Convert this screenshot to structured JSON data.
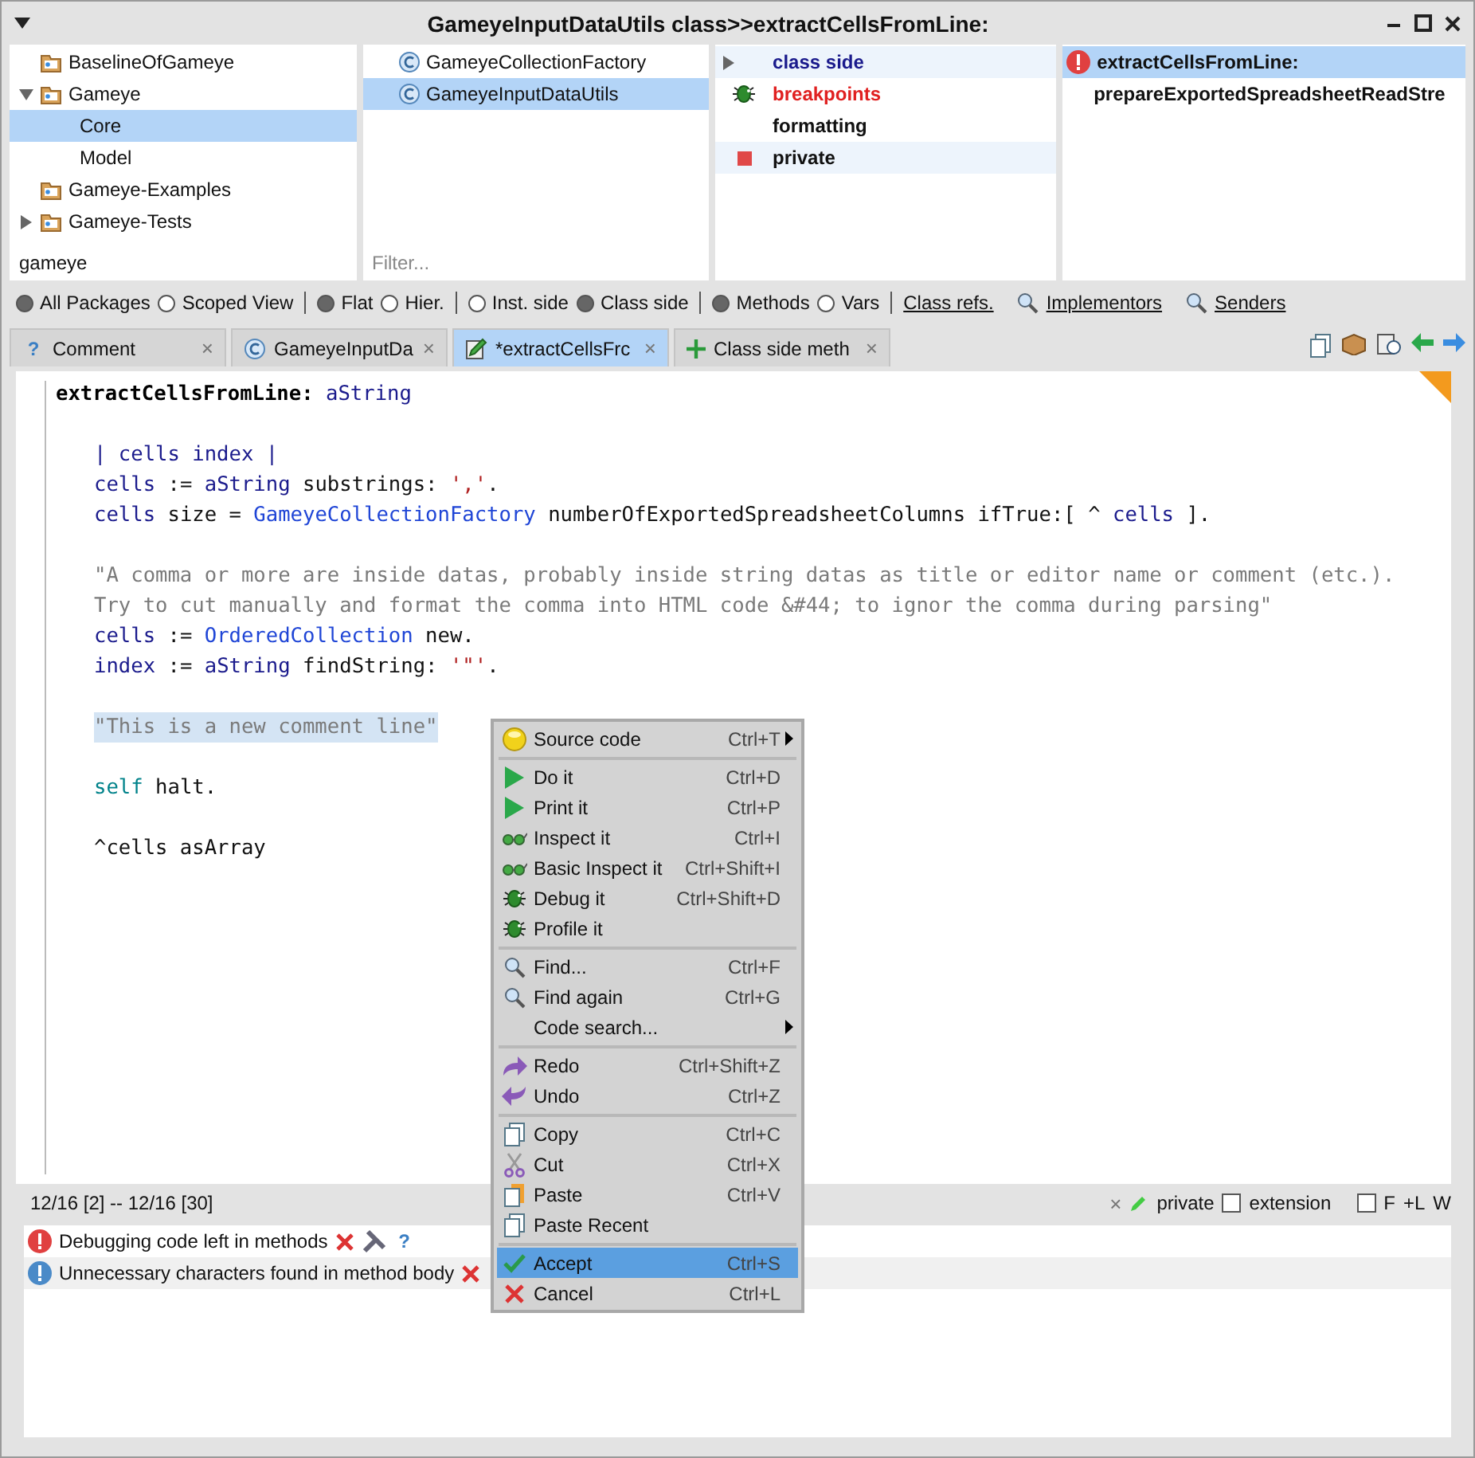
{
  "window": {
    "title": "GameyeInputDataUtils class>>extractCellsFromLine:"
  },
  "packages": {
    "items": [
      {
        "label": "BaselineOfGameye",
        "kind": "leaf",
        "selected": false
      },
      {
        "label": "Gameye",
        "kind": "expanded",
        "selected": false,
        "children": [
          {
            "label": "Core",
            "selected": true
          },
          {
            "label": "Model",
            "selected": false
          }
        ]
      },
      {
        "label": "Gameye-Examples",
        "kind": "leaf",
        "selected": false
      },
      {
        "label": "Gameye-Tests",
        "kind": "collapsed",
        "selected": false
      }
    ],
    "filter": "gameye"
  },
  "classes": {
    "items": [
      {
        "label": "GameyeCollectionFactory",
        "selected": false
      },
      {
        "label": "GameyeInputDataUtils",
        "selected": true
      }
    ],
    "filter_placeholder": "Filter..."
  },
  "protocols": {
    "items": [
      {
        "label": "class side",
        "kind": "side",
        "shaded": true
      },
      {
        "label": "breakpoints",
        "kind": "bug",
        "shaded": false
      },
      {
        "label": "formatting",
        "kind": "plain",
        "shaded": false
      },
      {
        "label": "private",
        "kind": "square",
        "shaded": true
      }
    ]
  },
  "methods": {
    "items": [
      {
        "label": "extractCellsFromLine:",
        "kind": "error",
        "selected": true
      },
      {
        "label": "prepareExportedSpreadsheetReadStre",
        "kind": "plain",
        "selected": false
      }
    ]
  },
  "toolbar": [
    {
      "kind": "radio",
      "label": "All Packages",
      "on": true
    },
    {
      "kind": "radio",
      "label": "Scoped View",
      "on": false
    },
    {
      "kind": "sep"
    },
    {
      "kind": "radio",
      "label": "Flat",
      "on": true
    },
    {
      "kind": "radio",
      "label": "Hier.",
      "on": false
    },
    {
      "kind": "sep"
    },
    {
      "kind": "radio",
      "label": "Inst. side",
      "on": false
    },
    {
      "kind": "radio",
      "label": "Class side",
      "on": true
    },
    {
      "kind": "sep"
    },
    {
      "kind": "radio",
      "label": "Methods",
      "on": true
    },
    {
      "kind": "radio",
      "label": "Vars",
      "on": false
    },
    {
      "kind": "sep"
    },
    {
      "kind": "link",
      "label": "Class refs."
    },
    {
      "kind": "search_link",
      "label": "Implementors"
    },
    {
      "kind": "search_link",
      "label": "Senders"
    }
  ],
  "tabs": [
    {
      "label": "Comment",
      "kind": "help",
      "icon_char": "?",
      "close": "×",
      "selected": false
    },
    {
      "label": "GameyeInputDa",
      "kind": "class",
      "close": "×",
      "selected": false
    },
    {
      "label": "*extractCellsFrc",
      "kind": "edit",
      "close": "×",
      "selected": true
    },
    {
      "label": "Class side meth",
      "kind": "plus",
      "close": "×",
      "selected": false
    }
  ],
  "code": [
    {
      "kind": "signature",
      "tokens": [
        {
          "t": "extractCellsFromLine:",
          "kind": "sel"
        },
        {
          "t": " aString",
          "kind": "arg"
        }
      ]
    },
    {
      "kind": "blank"
    },
    {
      "kind": "statement",
      "highlighted": false,
      "tokens": [
        {
          "t": "| cells index |",
          "kind": "tmp"
        }
      ]
    },
    {
      "kind": "statement",
      "highlighted": false,
      "tokens": [
        {
          "t": "cells",
          "kind": "tmp"
        },
        {
          "t": " := ",
          "kind": "txt"
        },
        {
          "t": "aString",
          "kind": "arg"
        },
        {
          "t": " substrings: ",
          "kind": "txt"
        },
        {
          "t": "','",
          "kind": "str"
        },
        {
          "t": ".",
          "kind": "txt"
        }
      ]
    },
    {
      "kind": "statement",
      "highlighted": false,
      "tokens": [
        {
          "t": "cells",
          "kind": "tmp"
        },
        {
          "t": " size = ",
          "kind": "txt"
        },
        {
          "t": "GameyeCollectionFactory",
          "kind": "cls"
        },
        {
          "t": " numberOfExportedSpreadsheetColumns ifTrue:[ ^ ",
          "kind": "txt"
        },
        {
          "t": "cells",
          "kind": "tmp"
        },
        {
          "t": " ].",
          "kind": "txt"
        }
      ]
    },
    {
      "kind": "blank"
    },
    {
      "kind": "statement",
      "highlighted": false,
      "tokens": [
        {
          "t": "\"A comma or more are inside datas, probably inside string datas as title or editor name or comment (etc.).",
          "kind": "cmt"
        }
      ]
    },
    {
      "kind": "statement",
      "highlighted": false,
      "tokens": [
        {
          "t": "Try to cut manually and format the comma into HTML code &#44; to ignor the comma during parsing\"",
          "kind": "cmt"
        }
      ]
    },
    {
      "kind": "statement",
      "highlighted": false,
      "tokens": [
        {
          "t": "cells",
          "kind": "tmp"
        },
        {
          "t": " := ",
          "kind": "txt"
        },
        {
          "t": "OrderedCollection",
          "kind": "cls"
        },
        {
          "t": " new.",
          "kind": "txt"
        }
      ]
    },
    {
      "kind": "statement",
      "highlighted": false,
      "tokens": [
        {
          "t": "index",
          "kind": "tmp"
        },
        {
          "t": " := ",
          "kind": "txt"
        },
        {
          "t": "aString",
          "kind": "arg"
        },
        {
          "t": " findString: ",
          "kind": "txt"
        },
        {
          "t": "'\"'",
          "kind": "str"
        },
        {
          "t": ".",
          "kind": "txt"
        }
      ]
    },
    {
      "kind": "blank"
    },
    {
      "kind": "statement",
      "highlighted": true,
      "tokens": [
        {
          "t": "\"This is a new comment line\"",
          "kind": "cmt"
        }
      ]
    },
    {
      "kind": "blank"
    },
    {
      "kind": "statement",
      "highlighted": false,
      "tokens": [
        {
          "t": "self",
          "kind": "self"
        },
        {
          "t": " halt.",
          "kind": "txt"
        }
      ]
    },
    {
      "kind": "blank"
    },
    {
      "kind": "statement",
      "highlighted": false,
      "tokens": [
        {
          "t": "^cells asArray",
          "kind": "txt"
        }
      ]
    }
  ],
  "status": {
    "position": "12/16 [2] -- 12/16 [30]",
    "clear": "×",
    "protocol": "private",
    "extension": {
      "label": "extension",
      "checked": false
    },
    "flag": {
      "label": "F",
      "checked": false
    },
    "line_mode": "+L",
    "wrap": "W"
  },
  "critiques": [
    {
      "kind": "error",
      "label": "Debugging code left in methods",
      "help": "?"
    },
    {
      "kind": "info",
      "label": "Unnecessary characters found in method body"
    }
  ],
  "context_menu": [
    {
      "kind": "bulb",
      "label": "Source code",
      "shortcut": "Ctrl+T",
      "submenu": true,
      "selected": false
    },
    {
      "kind": "separator"
    },
    {
      "kind": "play",
      "label": "Do it",
      "shortcut": "Ctrl+D",
      "submenu": false,
      "selected": false
    },
    {
      "kind": "play",
      "label": "Print it",
      "shortcut": "Ctrl+P",
      "submenu": false,
      "selected": false
    },
    {
      "kind": "glasses",
      "label": "Inspect it",
      "shortcut": "Ctrl+I",
      "submenu": false,
      "selected": false
    },
    {
      "kind": "glasses",
      "label": "Basic Inspect it",
      "shortcut": "Ctrl+Shift+I",
      "submenu": false,
      "selected": false
    },
    {
      "kind": "bug",
      "label": "Debug it",
      "shortcut": "Ctrl+Shift+D",
      "submenu": false,
      "selected": false
    },
    {
      "kind": "bug",
      "label": "Profile it",
      "submenu": false,
      "selected": false
    },
    {
      "kind": "separator"
    },
    {
      "kind": "search",
      "label": "Find...",
      "shortcut": "Ctrl+F",
      "submenu": false,
      "selected": false
    },
    {
      "kind": "search",
      "label": "Find again",
      "shortcut": "Ctrl+G",
      "submenu": false,
      "selected": false
    },
    {
      "kind": "plain",
      "label": "Code search...",
      "submenu": true,
      "selected": false
    },
    {
      "kind": "separator"
    },
    {
      "kind": "redo",
      "label": "Redo",
      "shortcut": "Ctrl+Shift+Z",
      "submenu": false,
      "selected": false
    },
    {
      "kind": "undo",
      "label": "Undo",
      "shortcut": "Ctrl+Z",
      "submenu": false,
      "selected": false
    },
    {
      "kind": "separator"
    },
    {
      "kind": "copy",
      "label": "Copy",
      "shortcut": "Ctrl+C",
      "submenu": false,
      "selected": false
    },
    {
      "kind": "cut",
      "label": "Cut",
      "shortcut": "Ctrl+X",
      "submenu": false,
      "selected": false
    },
    {
      "kind": "paste",
      "label": "Paste",
      "shortcut": "Ctrl+V",
      "submenu": false,
      "selected": false
    },
    {
      "kind": "copy",
      "label": "Paste Recent",
      "submenu": false,
      "selected": false
    },
    {
      "kind": "separator"
    },
    {
      "kind": "check",
      "label": "Accept",
      "shortcut": "Ctrl+S",
      "submenu": false,
      "selected": true
    },
    {
      "kind": "cancel",
      "label": "Cancel",
      "shortcut": "Ctrl+L",
      "submenu": false,
      "selected": false
    }
  ]
}
